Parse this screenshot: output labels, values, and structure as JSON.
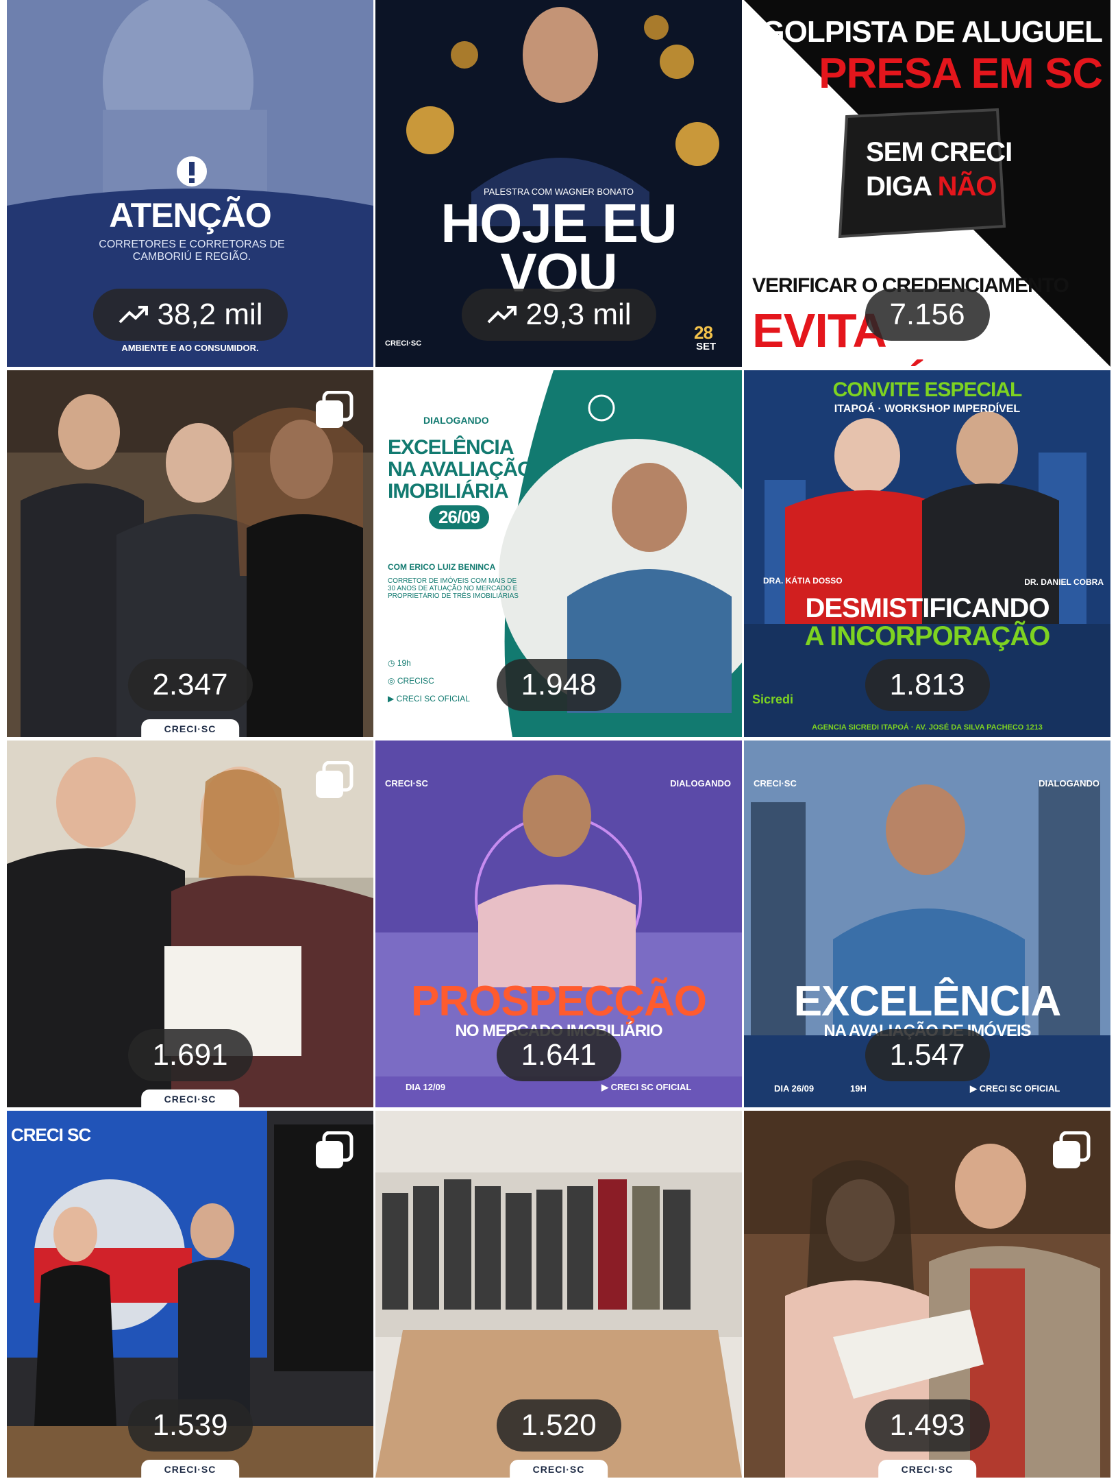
{
  "tiles": [
    {
      "count": "38,2 mil",
      "trending": true,
      "heading": "ATENÇÃO",
      "sub": "CORRETORES E CORRETORAS DE CAMBORIÚ E REGIÃO.",
      "footer": "AMBIENTE E AO CONSUMIDOR."
    },
    {
      "count": "29,3 mil",
      "trending": true,
      "heading": "HOJE EU VOU",
      "kicker": "PALESTRA COM WAGNER BONATO",
      "date_day": "28",
      "date_month": "SET",
      "logo": "CRECI·SC"
    },
    {
      "count": "7.156",
      "trending": false,
      "line1": "GOLPISTA DE ALUGUEL",
      "line2": "PRESA EM SC",
      "stamp1": "SEM CRECI",
      "stamp2a": "DIGA",
      "stamp2b": "NÃO",
      "line3": "VERIFICAR O CREDENCIAMENTO",
      "line4": "EVITA PREJUÍZO"
    },
    {
      "count": "2.347",
      "trending": false,
      "brand": "CRECI·SC"
    },
    {
      "count": "1.948",
      "trending": false,
      "logo": "DIALOGANDO",
      "heading1": "EXCELÊNCIA",
      "heading2": "NA AVALIAÇÃO",
      "heading3": "IMOBILIÁRIA",
      "date": "26/09",
      "with": "COM ERICO LUIZ BENINCA",
      "desc": "CORRETOR DE IMÓVEIS COM MAIS DE 30 ANOS DE ATUAÇÃO NO MERCADO E PROPRIETÁRIO DE TRÊS IMOBILIÁRIAS",
      "time": "19h",
      "insta": "CRECISC",
      "yt": "CRECI SC OFICIAL"
    },
    {
      "count": "1.813",
      "trending": false,
      "top1": "CONVITE ESPECIAL",
      "top2": "ITAPOÁ · WORKSHOP IMPERDÍVEL",
      "name1": "DRA. KÁTIA DOSSO",
      "name2": "DR. DANIEL COBRA",
      "title1": "DESMISTIFICANDO",
      "title2": "A INCORPORAÇÃO",
      "sponsor": "Sicredi",
      "address": "AGENCIA SICREDI ITAPOÁ · AV. JOSÉ DA SILVA PACHECO 1213"
    },
    {
      "count": "1.691",
      "trending": false,
      "brand": "CRECI·SC"
    },
    {
      "count": "1.641",
      "trending": false,
      "logo1": "CRECI·SC",
      "logo2": "DIALOGANDO",
      "title1": "PROSPECÇÃO",
      "title2": "NO MERCADO IMOBILIÁRIO",
      "date": "DIA 12/09",
      "yt": "CRECI SC OFICIAL"
    },
    {
      "count": "1.547",
      "trending": false,
      "logo1": "CRECI·SC",
      "logo2": "DIALOGANDO",
      "title1": "EXCELÊNCIA",
      "title2": "NA AVALIAÇÃO DE IMÓVEIS",
      "date": "DIA 26/09",
      "time": "19H",
      "yt": "CRECI SC OFICIAL"
    },
    {
      "count": "1.539",
      "trending": false,
      "banner": "CRECI SC",
      "brand": "CRECI·SC"
    },
    {
      "count": "1.520",
      "trending": false,
      "brand": "CRECI·SC"
    },
    {
      "count": "1.493",
      "trending": false,
      "brand": "CRECI·SC"
    }
  ]
}
